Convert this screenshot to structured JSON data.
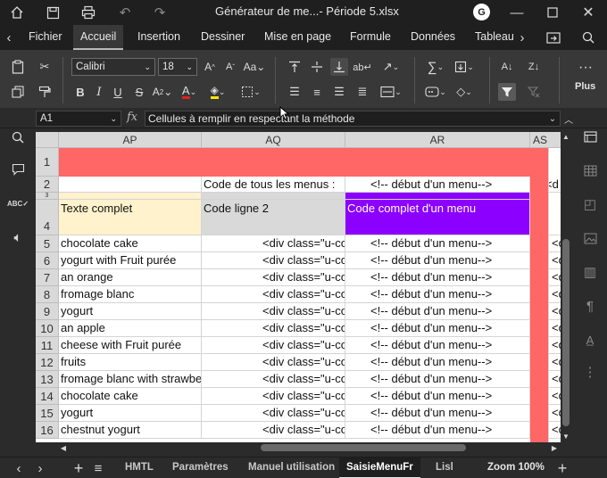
{
  "window": {
    "title": "Générateur de me...- Période 5.xlsx",
    "avatar": "G",
    "icons": [
      "home-icon",
      "save-icon",
      "print-icon",
      "undo-icon",
      "redo-icon",
      "minimize-icon",
      "maximize-icon",
      "close-icon"
    ]
  },
  "ribbon_tabs": [
    "Fichier",
    "Accueil",
    "Insertion",
    "Dessiner",
    "Mise en page",
    "Formule",
    "Données",
    "Tableau"
  ],
  "ribbon_active": "Accueil",
  "ribbon": {
    "font_name": "Calibri",
    "font_size": "18",
    "more_label": "Plus"
  },
  "formula_bar": {
    "name_box": "A1",
    "fx": "fx",
    "formula": "Cellules à remplir en respectant la méthode"
  },
  "columns": [
    "AP",
    "AQ",
    "AR",
    "AS"
  ],
  "row2": {
    "AQ": "Code de tous les menus :",
    "AR": "<!-- début d'un menu-->",
    "AS": "<d"
  },
  "row4": {
    "AP": "Texte complet",
    "AQ": "Code ligne 2",
    "AR": "Code complet d'un menu"
  },
  "rows": [
    {
      "num": "5",
      "ap": "chocolate cake",
      "aq": "<div class=\"u-co",
      "ar": "<!-- début d'un menu-->",
      "as": "<div clas"
    },
    {
      "num": "6",
      "ap": "yogurt with Fruit purée",
      "aq": "<div class=\"u-co",
      "ar": "<!-- début d'un menu-->",
      "as": "<div clas"
    },
    {
      "num": "7",
      "ap": "an orange",
      "aq": "<div class=\"u-co",
      "ar": "<!-- début d'un menu-->",
      "as": "<div clas"
    },
    {
      "num": "8",
      "ap": "fromage blanc",
      "aq": "<div class=\"u-co",
      "ar": "<!-- début d'un menu-->",
      "as": "<div clas"
    },
    {
      "num": "9",
      "ap": "yogurt",
      "aq": "<div class=\"u-co",
      "ar": "<!-- début d'un menu-->",
      "as": "<div clas"
    },
    {
      "num": "10",
      "ap": "an apple",
      "aq": "<div class=\"u-co",
      "ar": "<!-- début d'un menu-->",
      "as": "<div clas"
    },
    {
      "num": "11",
      "ap": "cheese with Fruit purée",
      "aq": "<div class=\"u-co",
      "ar": "<!-- début d'un menu-->",
      "as": "<div clas"
    },
    {
      "num": "12",
      "ap": "fruits",
      "aq": "<div class=\"u-co",
      "ar": "<!-- début d'un menu-->",
      "as": "<div clas"
    },
    {
      "num": "13",
      "ap": "fromage blanc with strawbe",
      "aq": "<div class=\"u-co",
      "ar": "<!-- début d'un menu-->",
      "as": "<div clas"
    },
    {
      "num": "14",
      "ap": "chocolate cake",
      "aq": "<div class=\"u-co",
      "ar": "<!-- début d'un menu-->",
      "as": "<div clas"
    },
    {
      "num": "15",
      "ap": "yogurt",
      "aq": "<div class=\"u-co",
      "ar": "<!-- début d'un menu-->",
      "as": "<div clas"
    },
    {
      "num": "16",
      "ap": "chestnut yogurt",
      "aq": "<div class=\"u-co",
      "ar": "<!-- début d'un menu-->",
      "as": "<div clas"
    }
  ],
  "colors": {
    "row1_fill": "#ff6666",
    "header_ap_fill": "#fff2cc",
    "header_aq_fill": "#d9d9d9",
    "header_ar_fill": "#8b00ff",
    "as_fill": "#ff6666"
  },
  "sheets": [
    "HMTL",
    "Paramètres",
    "Manuel utilisation",
    "SaisieMenuFr",
    "Lisl"
  ],
  "active_sheet": "SaisieMenuFr",
  "zoom": "Zoom 100%"
}
